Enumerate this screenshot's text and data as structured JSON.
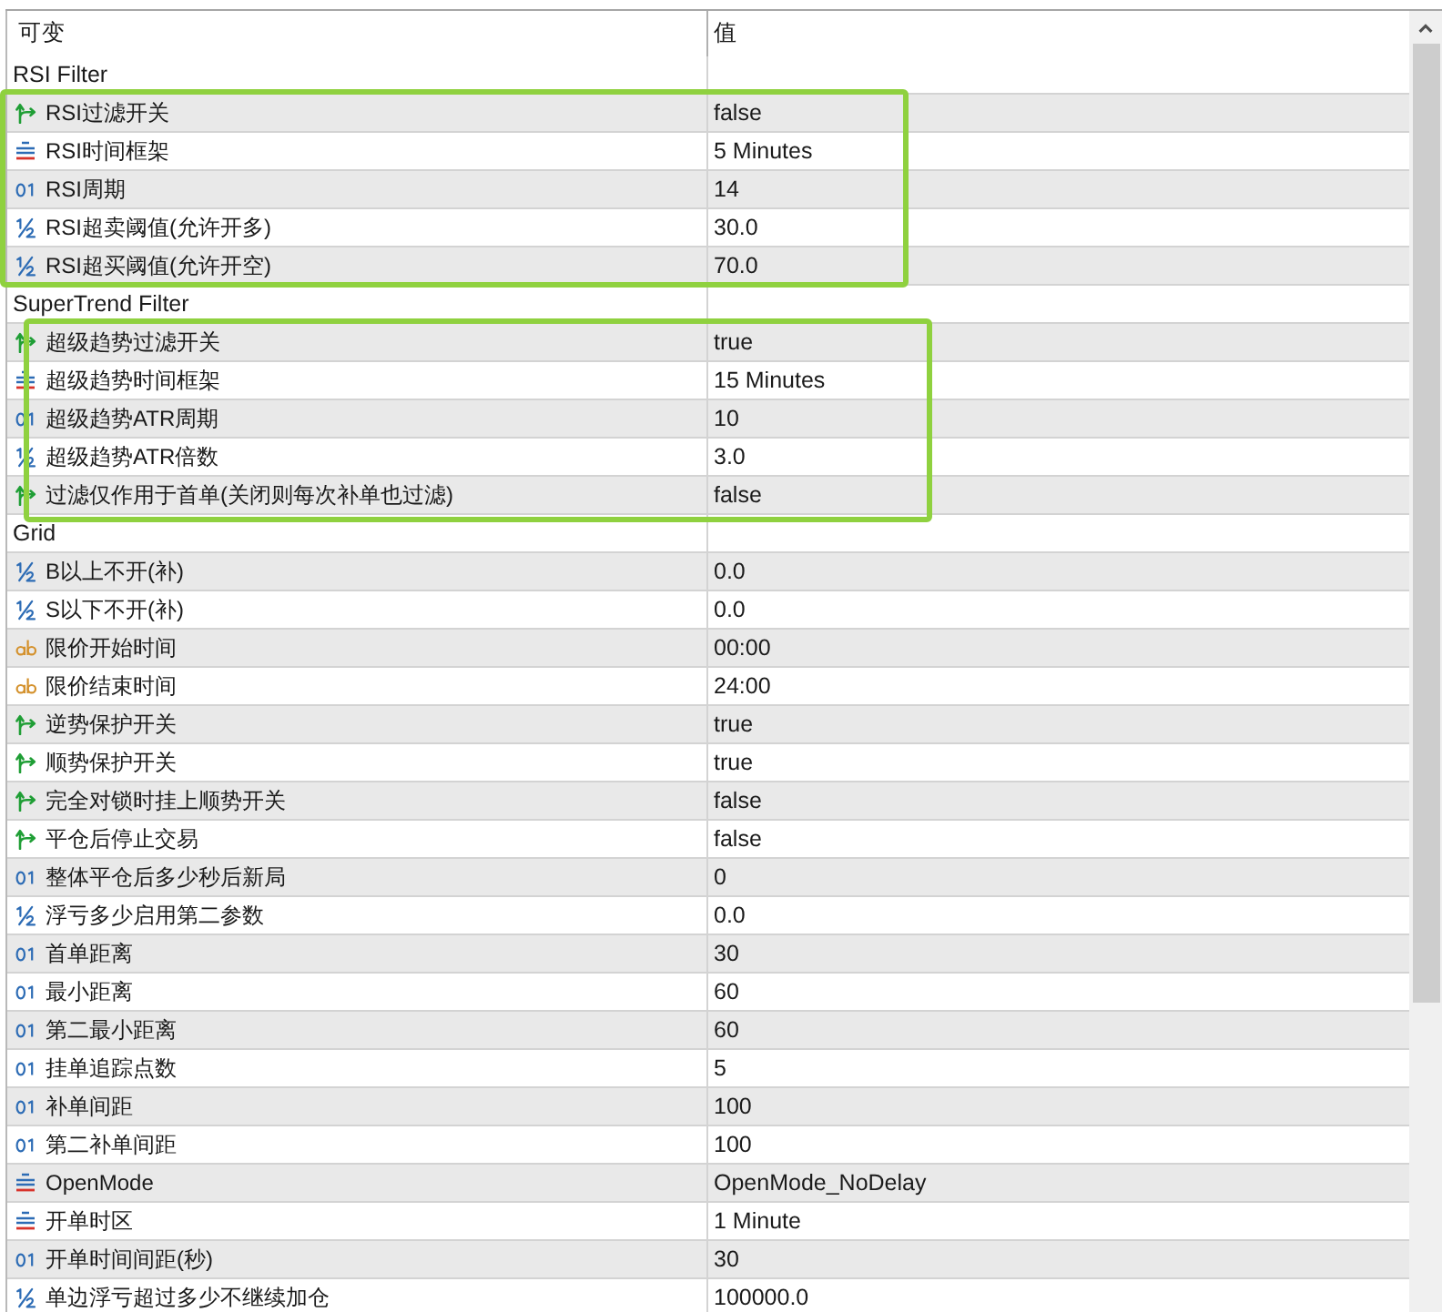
{
  "columns": [
    "可变",
    "值"
  ],
  "groups": [
    {
      "title": "RSI Filter",
      "highlighted": true,
      "rows": [
        {
          "kind": "bool",
          "name": "RSI过滤开关",
          "value": "false"
        },
        {
          "kind": "enum",
          "name": "RSI时间框架",
          "value": "5 Minutes"
        },
        {
          "kind": "int",
          "name": "RSI周期",
          "value": "14"
        },
        {
          "kind": "double",
          "name": "RSI超卖阈值(允许开多)",
          "value": "30.0"
        },
        {
          "kind": "double",
          "name": "RSI超买阈值(允许开空)",
          "value": "70.0"
        }
      ]
    },
    {
      "title": "SuperTrend Filter",
      "highlighted": true,
      "rows": [
        {
          "kind": "bool",
          "name": "超级趋势过滤开关",
          "value": "true"
        },
        {
          "kind": "enum",
          "name": "超级趋势时间框架",
          "value": "15 Minutes"
        },
        {
          "kind": "int",
          "name": "超级趋势ATR周期",
          "value": "10"
        },
        {
          "kind": "double",
          "name": "超级趋势ATR倍数",
          "value": "3.0"
        },
        {
          "kind": "bool",
          "name": "过滤仅作用于首单(关闭则每次补单也过滤)",
          "value": "false"
        }
      ]
    },
    {
      "title": "Grid",
      "highlighted": false,
      "rows": [
        {
          "kind": "double",
          "name": "B以上不开(补)",
          "value": "0.0"
        },
        {
          "kind": "double",
          "name": "S以下不开(补)",
          "value": "0.0"
        },
        {
          "kind": "string",
          "name": "限价开始时间",
          "value": "00:00"
        },
        {
          "kind": "string",
          "name": "限价结束时间",
          "value": "24:00"
        },
        {
          "kind": "bool",
          "name": "逆势保护开关",
          "value": "true"
        },
        {
          "kind": "bool",
          "name": "顺势保护开关",
          "value": "true"
        },
        {
          "kind": "bool",
          "name": "完全对锁时挂上顺势开关",
          "value": "false"
        },
        {
          "kind": "bool",
          "name": "平仓后停止交易",
          "value": "false"
        },
        {
          "kind": "int",
          "name": "整体平仓后多少秒后新局",
          "value": "0"
        },
        {
          "kind": "double",
          "name": "浮亏多少启用第二参数",
          "value": "0.0"
        },
        {
          "kind": "int",
          "name": "首单距离",
          "value": "30"
        },
        {
          "kind": "int",
          "name": "最小距离",
          "value": "60"
        },
        {
          "kind": "int",
          "name": "第二最小距离",
          "value": "60"
        },
        {
          "kind": "int",
          "name": "挂单追踪点数",
          "value": "5"
        },
        {
          "kind": "int",
          "name": "补单间距",
          "value": "100"
        },
        {
          "kind": "int",
          "name": "第二补单间距",
          "value": "100"
        },
        {
          "kind": "enum",
          "name": "OpenMode",
          "value": "OpenMode_NoDelay"
        },
        {
          "kind": "enum",
          "name": "开单时区",
          "value": "1 Minute"
        },
        {
          "kind": "int",
          "name": "开单时间间距(秒)",
          "value": "30"
        },
        {
          "kind": "double",
          "name": "单边浮亏超过多少不继续加仓",
          "value": "100000.0"
        }
      ]
    }
  ]
}
